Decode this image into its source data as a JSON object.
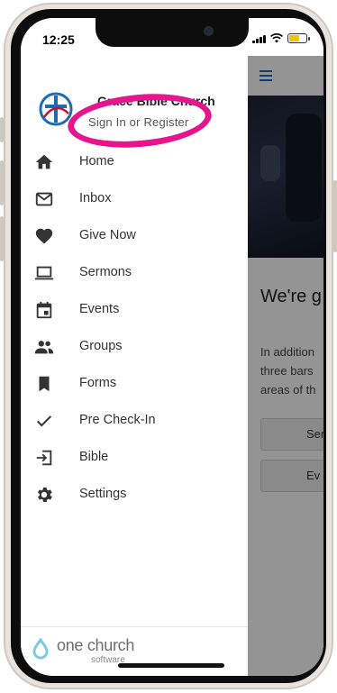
{
  "status_bar": {
    "time": "12:25"
  },
  "drawer": {
    "church_name": "Grace Bible Church",
    "sign_in_label": "Sign In or Register",
    "menu_items": [
      {
        "label": "Home",
        "icon": "home-icon"
      },
      {
        "label": "Inbox",
        "icon": "mail-icon"
      },
      {
        "label": "Give Now",
        "icon": "heart-icon"
      },
      {
        "label": "Sermons",
        "icon": "laptop-icon"
      },
      {
        "label": "Events",
        "icon": "calendar-icon"
      },
      {
        "label": "Groups",
        "icon": "people-icon"
      },
      {
        "label": "Forms",
        "icon": "bookmark-icon"
      },
      {
        "label": "Pre Check-In",
        "icon": "check-icon"
      },
      {
        "label": "Bible",
        "icon": "login-arrow-icon"
      },
      {
        "label": "Settings",
        "icon": "gear-icon"
      }
    ],
    "footer": {
      "brand": "one church",
      "sub": "software"
    }
  },
  "background_app": {
    "heading": "We're g",
    "paragraph_lines": [
      "In addition",
      "three bars",
      "areas of th"
    ],
    "buttons": [
      "Ser",
      "Ev"
    ]
  },
  "colors": {
    "highlight": "#e6158d",
    "accent": "#1f6bb0",
    "icon": "#333333",
    "battery": "#f4c400"
  }
}
